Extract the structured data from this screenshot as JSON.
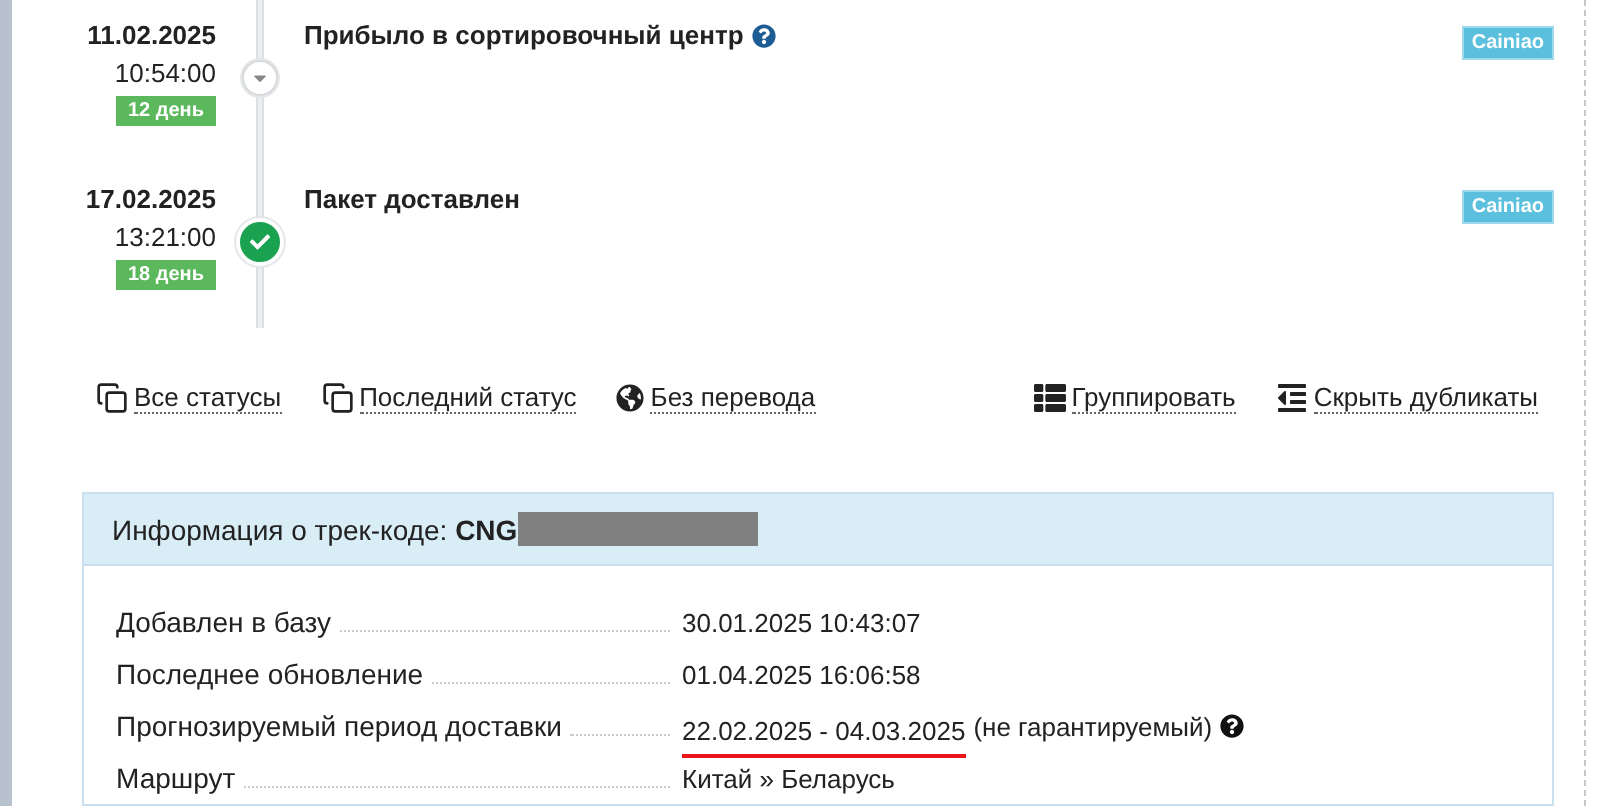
{
  "events": [
    {
      "date": "11.02.2025",
      "time": "10:54:00",
      "days": "12 день",
      "title": "Прибыло в сортировочный центр",
      "help": true,
      "kind": "transit",
      "source": "Cainiao"
    },
    {
      "date": "17.02.2025",
      "time": "13:21:00",
      "days": "18 день",
      "title": "Пакет доставлен",
      "help": false,
      "kind": "delivered",
      "source": "Cainiao"
    }
  ],
  "links_left": [
    {
      "label": "Все статусы",
      "kind": "copy"
    },
    {
      "label": "Последний статус",
      "kind": "copy"
    },
    {
      "label": "Без перевода",
      "kind": "globe"
    }
  ],
  "links_right": [
    {
      "label": "Группировать",
      "kind": "list"
    },
    {
      "label": "Скрыть дубликаты",
      "kind": "outdent"
    }
  ],
  "info": {
    "title": "Информация о трек-коде:",
    "code": "CNG",
    "redacted": true,
    "rows": [
      {
        "label": "Добавлен в базу",
        "value": "30.01.2025 10:43:07",
        "underlined": false
      },
      {
        "label": "Последнее обновление",
        "value": "01.04.2025 16:06:58",
        "underlined": false
      },
      {
        "label": "Прогнозируемый период доставки",
        "value": "22.02.2025 - 04.03.2025",
        "note": "(не гарантируемый)",
        "help": true,
        "underlined": true
      },
      {
        "label": "Маршрут",
        "value": "Китай » Беларусь",
        "underlined": false
      }
    ]
  }
}
